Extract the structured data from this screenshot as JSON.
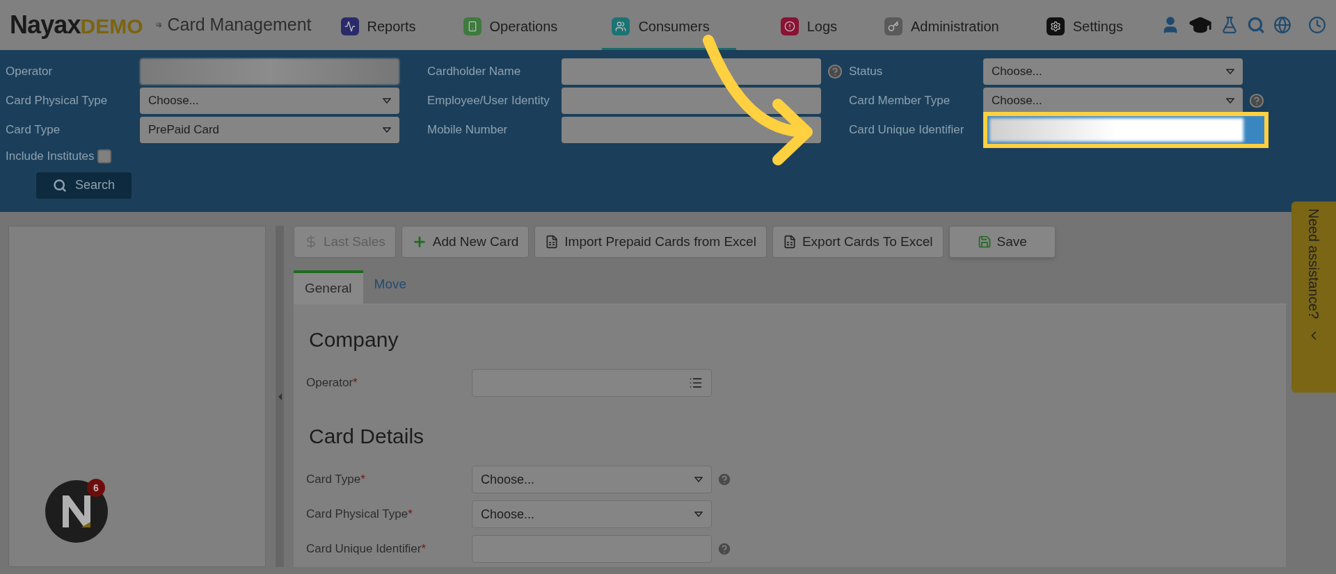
{
  "brand": {
    "name": "Nayax",
    "tag": "DEMO"
  },
  "app_title": "Card Management",
  "nav": [
    {
      "label": "Reports",
      "selected": false,
      "color": "#2a2a6a"
    },
    {
      "label": "Operations",
      "selected": false,
      "color": "#3e7a3e"
    },
    {
      "label": "Consumers",
      "selected": true,
      "color": "#1b7474"
    },
    {
      "label": "Logs",
      "selected": false,
      "color": "#8a1234"
    },
    {
      "label": "Administration",
      "selected": false,
      "color": "#5a5a5a"
    },
    {
      "label": "Settings",
      "selected": false,
      "color": "#111111"
    }
  ],
  "filters": [
    {
      "label": "Operator",
      "kind": "blurred",
      "help": false
    },
    {
      "label": "Cardholder Name",
      "kind": "text",
      "help": true
    },
    {
      "label": "Status",
      "kind": "select",
      "value": "Choose...",
      "help": false
    },
    {
      "label": "Card Physical Type",
      "kind": "select",
      "value": "Choose...",
      "help": false
    },
    {
      "label": "Employee/User Identity",
      "kind": "text",
      "help": false
    },
    {
      "label": "Card Member Type",
      "kind": "select",
      "value": "Choose...",
      "help": true
    },
    {
      "label": "Card Type",
      "kind": "select",
      "value": "PrePaid Card",
      "help": false
    },
    {
      "label": "Mobile Number",
      "kind": "text",
      "help": false
    },
    {
      "label": "Card Unique Identifier",
      "kind": "highlighted",
      "help": false
    }
  ],
  "include_institutes": {
    "label": "Include Institutes",
    "checked": false
  },
  "search_button": "Search",
  "toolbar": [
    {
      "label": "Last Sales",
      "kind": "dollar",
      "disabled": true
    },
    {
      "label": "Add New Card",
      "kind": "add",
      "disabled": false
    },
    {
      "label": "Import Prepaid Cards from Excel",
      "kind": "excel",
      "disabled": false
    },
    {
      "label": "Export Cards To Excel",
      "kind": "excel",
      "disabled": false
    },
    {
      "label": "Save",
      "kind": "save",
      "disabled": false
    }
  ],
  "tabs": [
    {
      "label": "General",
      "selected": true
    },
    {
      "label": "Move",
      "selected": false
    }
  ],
  "sections": [
    {
      "title": "Company",
      "fields": [
        {
          "label": "Operator",
          "required_mark": "*",
          "kind": "list",
          "help": false
        }
      ]
    },
    {
      "title": "Card Details",
      "fields": [
        {
          "label": "Card Type",
          "required_mark": "*",
          "kind": "select",
          "value": "Choose...",
          "help": true
        },
        {
          "label": "Card Physical Type",
          "required_mark": "*",
          "kind": "select",
          "value": "Choose...",
          "help": false
        },
        {
          "label": "Card Unique Identifier",
          "required_mark": "*",
          "kind": "text",
          "help": true
        }
      ]
    }
  ],
  "notification_badge": "6",
  "assistance": "Need assistance?"
}
